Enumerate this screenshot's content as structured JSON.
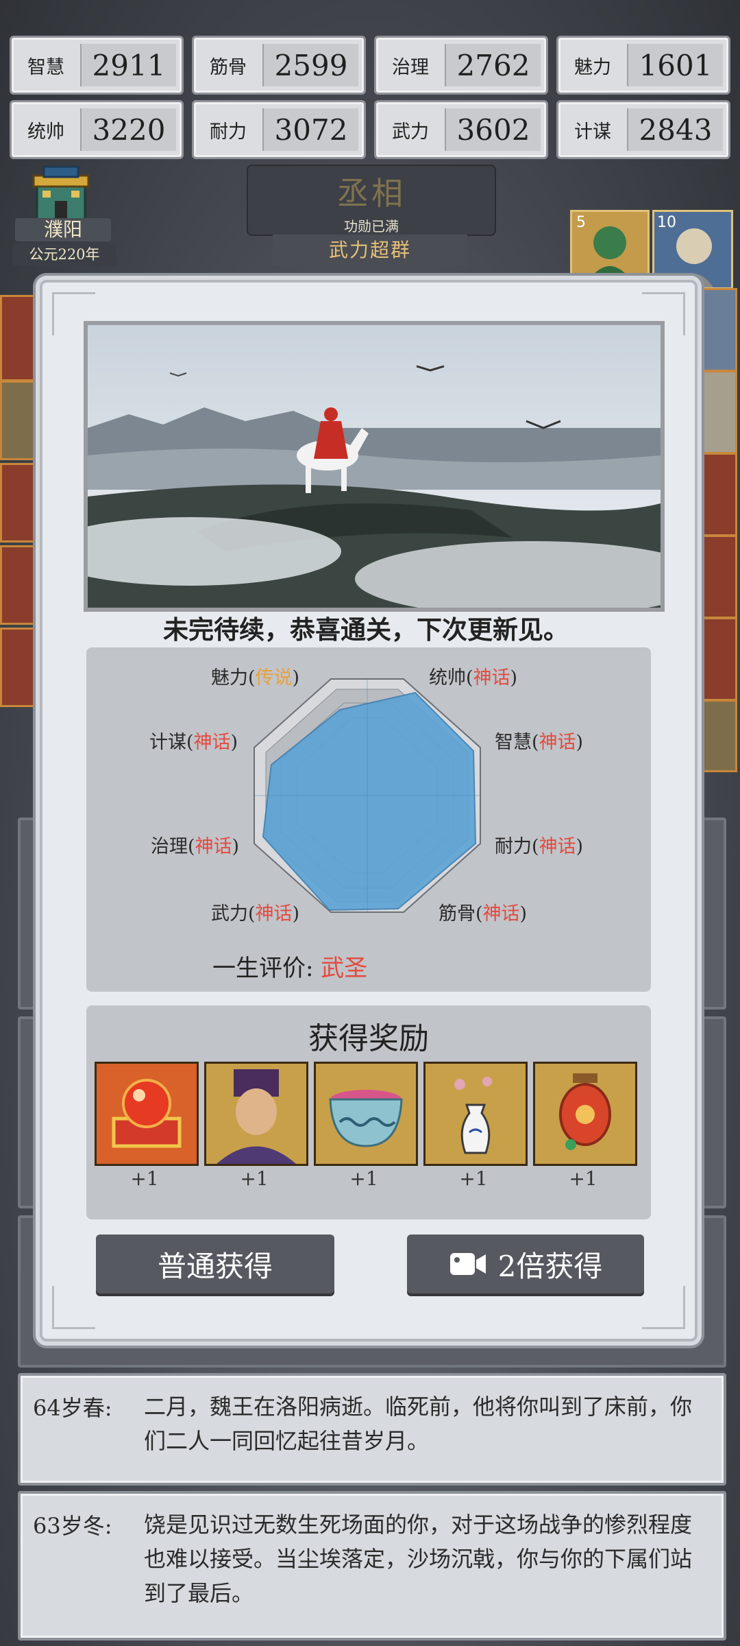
{
  "stats": [
    {
      "label": "智慧",
      "value": "2911"
    },
    {
      "label": "筋骨",
      "value": "2599"
    },
    {
      "label": "治理",
      "value": "2762"
    },
    {
      "label": "魅力",
      "value": "1601"
    },
    {
      "label": "统帅",
      "value": "3220"
    },
    {
      "label": "耐力",
      "value": "3072"
    },
    {
      "label": "武力",
      "value": "3602"
    },
    {
      "label": "计谋",
      "value": "2843"
    }
  ],
  "city": {
    "name": "濮阳",
    "year": "公元220年"
  },
  "title": {
    "rank": "丞相",
    "merit": "功勋已满",
    "tag": "武力超群"
  },
  "portrait_levels": [
    "5",
    "10"
  ],
  "modal": {
    "caption": "未完待续，恭喜通关，下次更新见。",
    "radar_labels": [
      {
        "name": "魅力",
        "grade": "传说"
      },
      {
        "name": "统帅",
        "grade": "神话"
      },
      {
        "name": "计谋",
        "grade": "神话"
      },
      {
        "name": "智慧",
        "grade": "神话"
      },
      {
        "name": "治理",
        "grade": "神话"
      },
      {
        "name": "耐力",
        "grade": "神话"
      },
      {
        "name": "武力",
        "grade": "神话"
      },
      {
        "name": "筋骨",
        "grade": "神话"
      }
    ],
    "eval_label": "一生评价:",
    "eval_value": "武圣",
    "reward_title": "获得奖励",
    "rewards": [
      "+1",
      "+1",
      "+1",
      "+1",
      "+1"
    ],
    "btn_normal": "普通获得",
    "btn_double": "2倍获得"
  },
  "colors": {
    "myth": "#e24b3f",
    "legend": "#e9a13a",
    "radar_fill": "#5ba3d6"
  },
  "logs": [
    {
      "age": "64岁春:",
      "text": "二月，魏王在洛阳病逝。临死前，他将你叫到了床前，你们二人一同回忆起往昔岁月。"
    },
    {
      "age": "63岁冬:",
      "text": "饶是见识过无数生死场面的你，对于这场战争的惨烈程度也难以接受。当尘埃落定，沙场沉戟，你与你的下属们站到了最后。"
    }
  ]
}
